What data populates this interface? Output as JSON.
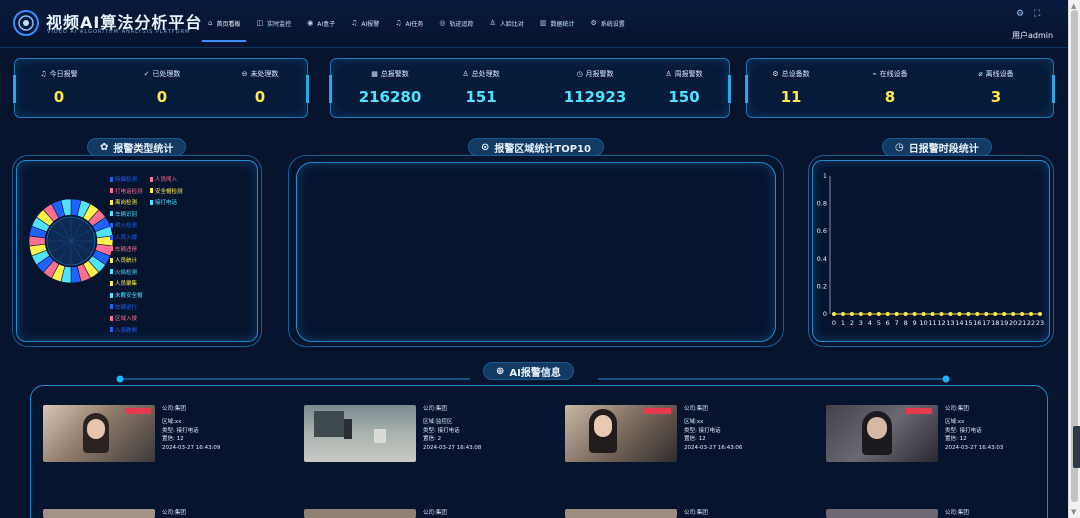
{
  "app": {
    "title": "视频AI算法分析平台",
    "subtitle": "VIDEO AI ALGORITHM ANALYSIS PLATFORM"
  },
  "nav": [
    {
      "label": "首页看板",
      "icon": "home-icon",
      "active": true
    },
    {
      "label": "实时监控",
      "icon": "camera-icon"
    },
    {
      "label": "AI盒子",
      "icon": "box-icon"
    },
    {
      "label": "AI报警",
      "icon": "bell-icon"
    },
    {
      "label": "AI任务",
      "icon": "bell-icon"
    },
    {
      "label": "轨迹追踪",
      "icon": "eye-icon"
    },
    {
      "label": "人脸比对",
      "icon": "person-icon"
    },
    {
      "label": "数据统计",
      "icon": "bar-chart-icon"
    },
    {
      "label": "系统设置",
      "icon": "gear-icon"
    }
  ],
  "header_right": {
    "user": "用户admin"
  },
  "stats_alarm": [
    {
      "label": "今日报警",
      "value": "0",
      "icon": "bell-icon"
    },
    {
      "label": "已处理数",
      "value": "0",
      "icon": "check-circle-icon"
    },
    {
      "label": "未处理数",
      "value": "0",
      "icon": "minus-circle-icon"
    }
  ],
  "stats_total": [
    {
      "label": "总报警数",
      "value": "216280",
      "icon": "building-icon"
    },
    {
      "label": "总处理数",
      "value": "151",
      "icon": "person-icon"
    },
    {
      "label": "月报警数",
      "value": "112923",
      "icon": "clock-circle-icon"
    },
    {
      "label": "周报警数",
      "value": "150",
      "icon": "person-icon"
    }
  ],
  "stats_device": [
    {
      "label": "总设备数",
      "value": "11",
      "icon": "gear-icon"
    },
    {
      "label": "在线设备",
      "value": "8",
      "icon": "signal-icon"
    },
    {
      "label": "离线设备",
      "value": "3",
      "icon": "signal-off-icon"
    }
  ],
  "sections": {
    "type_stats": "报警类型统计",
    "region_top10": "报警区域统计TOP10",
    "hourly_stats": "日报警时段统计",
    "ai_alarm": "AI报警信息"
  },
  "pie_legend": [
    {
      "label": "吸烟检测",
      "color": "#1e63ff"
    },
    {
      "label": "人员闯入",
      "color": "#ff6f91"
    },
    {
      "label": "打电话检测",
      "color": "#ff6f91"
    },
    {
      "label": "安全帽检测",
      "color": "#fff24a"
    },
    {
      "label": "离岗检测",
      "color": "#fff24a"
    },
    {
      "label": "接打电话",
      "color": "#4fe3ff"
    },
    {
      "label": "车辆识别",
      "color": "#4fe3ff"
    },
    {
      "label": "明火检测",
      "color": "#1e63ff"
    },
    {
      "label": "人员入侵",
      "color": "#1e63ff"
    },
    {
      "label": "车辆违停",
      "color": "#ff6f91"
    },
    {
      "label": "人员统计",
      "color": "#fff24a"
    },
    {
      "label": "火焰检测",
      "color": "#4fe3ff"
    },
    {
      "label": "人员聚集",
      "color": "#fff24a"
    },
    {
      "label": "未戴安全帽",
      "color": "#4fe3ff"
    },
    {
      "label": "车辆逆行",
      "color": "#1e63ff"
    },
    {
      "label": "区域入侵",
      "color": "#ff6f91"
    },
    {
      "label": "人员跌倒",
      "color": "#1e63ff"
    }
  ],
  "chart_data": {
    "type": "line",
    "title": "日报警时段统计",
    "x": [
      0,
      1,
      2,
      3,
      4,
      5,
      6,
      7,
      8,
      9,
      10,
      11,
      12,
      13,
      14,
      15,
      16,
      17,
      18,
      19,
      20,
      21,
      22,
      23
    ],
    "y": [
      0,
      0,
      0,
      0,
      0,
      0,
      0,
      0,
      0,
      0,
      0,
      0,
      0,
      0,
      0,
      0,
      0,
      0,
      0,
      0,
      0,
      0,
      0,
      0
    ],
    "yticks": [
      "0",
      "0.2",
      "0.4",
      "0.6",
      "0.8",
      "1"
    ],
    "ylim": [
      0,
      1
    ],
    "grid": false,
    "colors": {
      "line": "#ffe84a",
      "point": "#ffe84a"
    }
  },
  "alarms": [
    {
      "company": "公司:集团",
      "region": "区域:xx",
      "type": "类型: 接打电话",
      "confidence": "置信: 12",
      "time": "2024-03-27 16:43:09"
    },
    {
      "company": "公司:集团",
      "region": "区域:监控区",
      "type": "类型: 接打电话",
      "confidence": "置信: 2",
      "time": "2024-03-27 16:43:08"
    },
    {
      "company": "公司:集团",
      "region": "区域:xx",
      "type": "类型: 接打电话",
      "confidence": "置信: 12",
      "time": "2024-03-27 16:43:06"
    },
    {
      "company": "公司:集团",
      "region": "区域:xx",
      "type": "类型: 接打电话",
      "confidence": "置信: 12",
      "time": "2024-03-27 16:43:03"
    }
  ],
  "alarms_row2": [
    {
      "company": "公司:集团"
    },
    {
      "company": "公司:集团"
    },
    {
      "company": "公司:集团"
    },
    {
      "company": "公司:集团"
    }
  ],
  "colors": {
    "bg": "#06142e",
    "accent": "#1a8fd0",
    "yellow": "#ffe84a",
    "cyan": "#4fe3ff"
  }
}
